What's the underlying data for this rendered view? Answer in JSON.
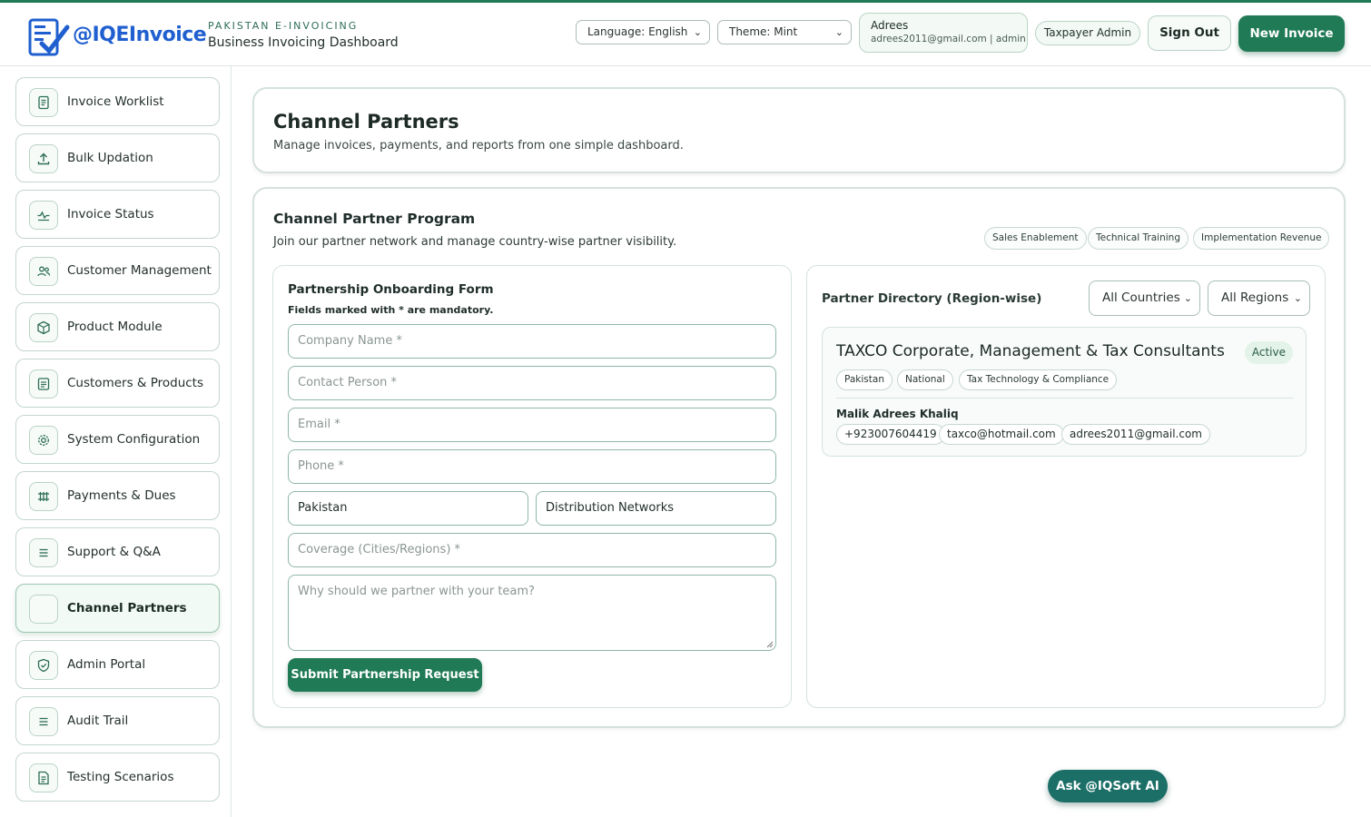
{
  "brand": {
    "logo_text": "@IQEInvoice",
    "kicker": "PAKISTAN E-INVOICING",
    "title": "Business Invoicing Dashboard"
  },
  "header": {
    "language_select": "Language: English",
    "theme_select": "Theme: Mint",
    "user_name": "Adrees",
    "user_meta": "adrees2011@gmail.com | admin",
    "role": "Taxpayer Admin",
    "sign_out": "Sign Out",
    "new_invoice": "New Invoice"
  },
  "sidebar": {
    "items": [
      {
        "label": "Invoice Worklist",
        "icon": "document-icon"
      },
      {
        "label": "Bulk Updation",
        "icon": "upload-icon"
      },
      {
        "label": "Invoice Status",
        "icon": "activity-icon"
      },
      {
        "label": "Customer Management",
        "icon": "users-icon"
      },
      {
        "label": "Product Module",
        "icon": "box-icon"
      },
      {
        "label": "Customers & Products",
        "icon": "document-icon"
      },
      {
        "label": "System Configuration",
        "icon": "gear-icon"
      },
      {
        "label": "Payments & Dues",
        "icon": "grid-icon"
      },
      {
        "label": "Support & Q&A",
        "icon": "menu-icon"
      },
      {
        "label": "Channel Partners",
        "icon": "blank-icon",
        "active": true
      },
      {
        "label": "Admin Portal",
        "icon": "shield-icon"
      },
      {
        "label": "Audit Trail",
        "icon": "menu-icon"
      },
      {
        "label": "Testing Scenarios",
        "icon": "document-icon"
      }
    ]
  },
  "page": {
    "title": "Channel Partners",
    "subtitle": "Manage invoices, payments, and reports from one simple dashboard."
  },
  "program": {
    "title": "Channel Partner Program",
    "subtitle": "Join our partner network and manage country-wise partner visibility.",
    "tags": [
      "Sales Enablement",
      "Technical Training",
      "Implementation Revenue"
    ]
  },
  "form": {
    "title": "Partnership Onboarding Form",
    "note": "Fields marked with * are mandatory.",
    "company_placeholder": "Company Name *",
    "contact_placeholder": "Contact Person *",
    "email_placeholder": "Email *",
    "phone_placeholder": "Phone *",
    "country_value": "Pakistan",
    "type_value": "Distribution Networks",
    "coverage_placeholder": "Coverage (Cities/Regions) *",
    "reason_placeholder": "Why should we partner with your team?",
    "submit": "Submit Partnership Request"
  },
  "directory": {
    "title": "Partner Directory (Region-wise)",
    "country_filter": "All Countries",
    "region_filter": "All Regions",
    "partner": {
      "name": "TAXCO Corporate, Management & Tax Consultants",
      "status": "Active",
      "tags": [
        "Pakistan",
        "National",
        "Tax Technology & Compliance"
      ],
      "contact_name": "Malik Adrees Khaliq",
      "phone": "+923007604419",
      "email1": "taxco@hotmail.com",
      "email2": "adrees2011@gmail.com"
    }
  },
  "assistant": {
    "label": "Ask @IQSoft AI"
  },
  "colors": {
    "accent": "#1f7a55",
    "assistant": "#1b6f67",
    "logo": "#1f5fcf"
  }
}
